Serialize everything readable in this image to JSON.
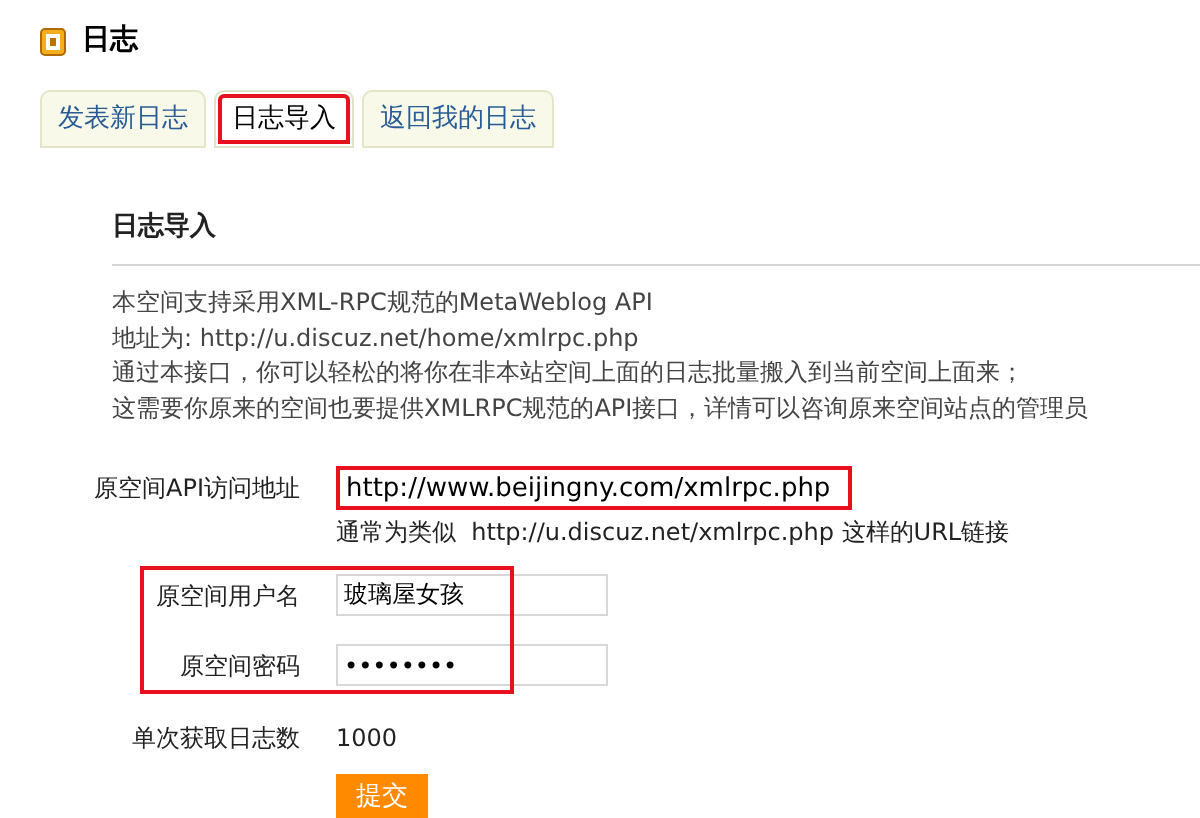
{
  "header": {
    "title": "日志"
  },
  "tabs": [
    {
      "label": "发表新日志",
      "selected": false,
      "highlighted": false
    },
    {
      "label": "日志导入",
      "selected": true,
      "highlighted": true
    },
    {
      "label": "返回我的日志",
      "selected": false,
      "highlighted": false
    }
  ],
  "section": {
    "title": "日志导入",
    "intro": [
      "本空间支持采用XML-RPC规范的MetaWeblog API",
      "地址为: http://u.discuz.net/home/xmlrpc.php",
      "通过本接口，你可以轻松的将你在非本站空间上面的日志批量搬入到当前空间上面来；",
      "这需要你原来的空间也要提供XMLRPC规范的API接口，详情可以咨询原来空间站点的管理员"
    ]
  },
  "form": {
    "api_url": {
      "label": "原空间API访问地址",
      "value": "http://www.beijingny.com/xmlrpc.php",
      "hint": "通常为类似  http://u.discuz.net/xmlrpc.php 这样的URL链接",
      "highlighted": true
    },
    "credentials_highlighted": true,
    "username": {
      "label": "原空间用户名",
      "value": "玻璃屋女孩"
    },
    "password": {
      "label": "原空间密码",
      "value": "••••••••"
    },
    "count": {
      "label": "单次获取日志数",
      "value": "1000"
    },
    "submit": "提交"
  }
}
